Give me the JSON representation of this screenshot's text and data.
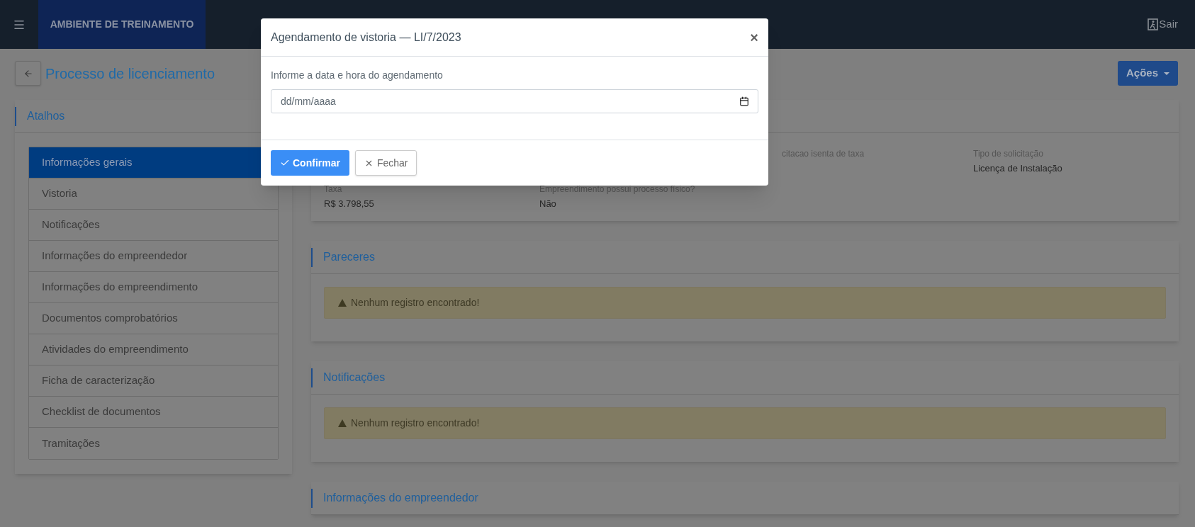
{
  "header": {
    "brand": "AMBIENTE DE TREINAMENTO",
    "logout": "Sair"
  },
  "page": {
    "title": "Processo de licenciamento",
    "actions_button": "Ações"
  },
  "shortcuts": {
    "title": "Atalhos",
    "items": [
      {
        "label": "Informações gerais",
        "selected": true
      },
      {
        "label": "Vistoria",
        "selected": false
      },
      {
        "label": "Notificações",
        "selected": false
      },
      {
        "label": "Informações do empreendedor",
        "selected": false
      },
      {
        "label": "Informações do empreendimento",
        "selected": false
      },
      {
        "label": "Documentos comprobatórios",
        "selected": false
      },
      {
        "label": "Atividades do empreendimento",
        "selected": false
      },
      {
        "label": "Ficha de caracterização",
        "selected": false
      },
      {
        "label": "Checklist de documentos",
        "selected": false
      },
      {
        "label": "Tramitações",
        "selected": false
      }
    ]
  },
  "general_info": {
    "rows": [
      [
        {
          "label": "citacao isenta de taxa"
        },
        {
          "label": "Tipo de solicitação",
          "value": "Licença de Instalação"
        }
      ],
      [
        {
          "label": "Taxa",
          "value": "R$ 3.798,55"
        },
        {
          "label": "Empreendimento possui processo físico?",
          "value": "Não"
        }
      ]
    ]
  },
  "sections": [
    {
      "title": "Pareceres",
      "alert": "Nenhum registro encontrado!"
    },
    {
      "title": "Notificações",
      "alert": "Nenhum registro encontrado!"
    },
    {
      "title": "Informações do empreendedor"
    }
  ],
  "modal": {
    "title": "Agendamento de vistoria — LI/7/2023",
    "close": "×",
    "field_label": "Informe a data e hora do agendamento",
    "placeholder": "dd/mm/aaaa",
    "confirm": "Confirmar",
    "dismiss": "Fechar"
  }
}
